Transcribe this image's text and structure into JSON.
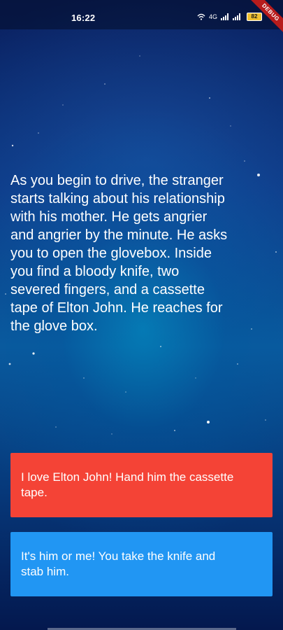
{
  "status_bar": {
    "time": "16:22",
    "icons": [
      "wifi-icon",
      "volte-icon",
      "signal-icon",
      "signal-icon",
      "battery-icon"
    ],
    "network_label": "4G",
    "battery_level": "82"
  },
  "debug_banner": "DEBUG",
  "story": {
    "text": "As you begin to drive, the stranger\nstarts talking about his relationship\nwith his mother. He gets angrier\nand angrier by the minute. He asks\nyou to open the glovebox. Inside\nyou find a bloody knife, two\nsevered fingers, and a cassette\ntape of Elton John. He reaches for\nthe glove box."
  },
  "choices": [
    {
      "label": "I love Elton John! Hand him the cassette\ntape.",
      "color": "#f44336"
    },
    {
      "label": "It's him or me! You take the knife and\nstab him.",
      "color": "#2196f3"
    }
  ],
  "colors": {
    "choice_1": "#f44336",
    "choice_2": "#2196f3",
    "background_top": "#0a1f5e",
    "background_mid": "#0a5a9e",
    "debug_banner": "#b71c1c"
  }
}
